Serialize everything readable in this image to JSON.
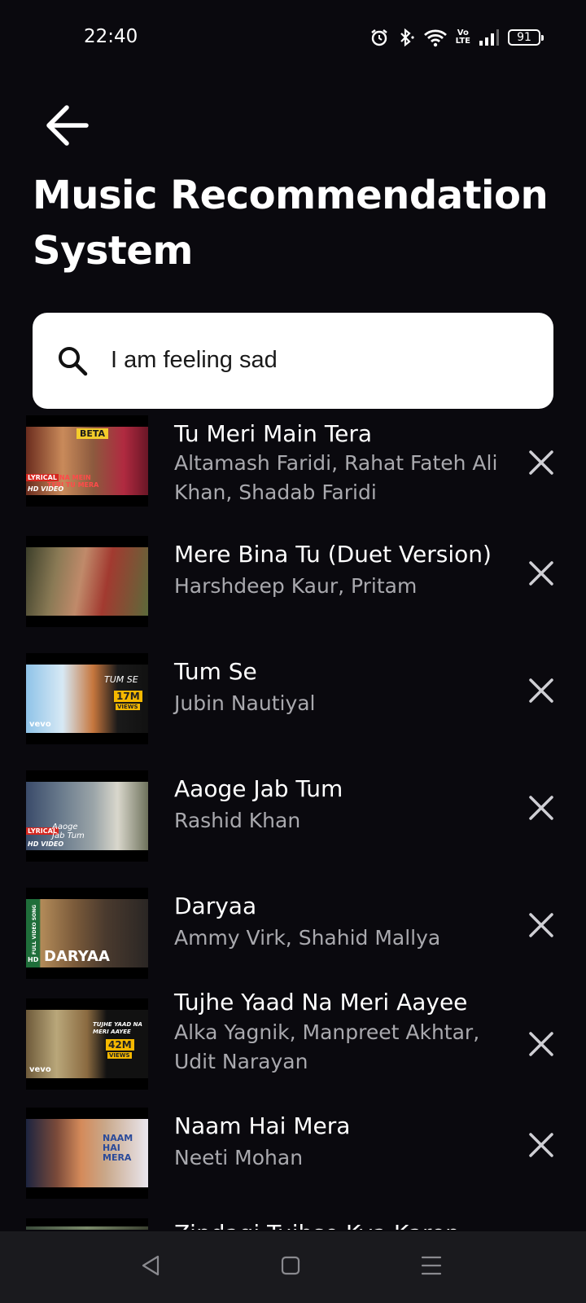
{
  "status_bar": {
    "time": "22:40",
    "battery": "91",
    "volte_top": "Vo",
    "volte_bottom": "LTE"
  },
  "header": {
    "title": "Music Recommendation System"
  },
  "search": {
    "value": "I am feeling sad",
    "placeholder": ""
  },
  "songs": [
    {
      "title": "Tu Meri Main Tera",
      "artists": "Altamash Faridi, Rahat Fateh Ali Khan, Shadab Faridi",
      "thumb": {
        "badge": "BETA",
        "caption": "SAJNA MEIN TERI TU MERA",
        "tag": "LYRICAL",
        "hd": "HD VIDEO"
      }
    },
    {
      "title": "Mere Bina Tu (Duet Version)",
      "artists": "Harshdeep Kaur, Pritam",
      "thumb": {}
    },
    {
      "title": "Tum Se",
      "artists": "Jubin Nautiyal",
      "thumb": {
        "caption": "TUM SE",
        "views": "17M",
        "views_label": "VIEWS",
        "logo": "vevo"
      }
    },
    {
      "title": "Aaoge Jab Tum",
      "artists": "Rashid Khan",
      "thumb": {
        "tag": "LYRICAL",
        "caption": "Aaoge Jab Tum",
        "hd": "HD VIDEO"
      }
    },
    {
      "title": "Daryaa",
      "artists": "Ammy Virk, Shahid Mallya",
      "thumb": {
        "caption": "DARYAA",
        "side": "FULL VIDEO SONG",
        "hd": "HD"
      }
    },
    {
      "title": "Tujhe Yaad Na Meri Aayee",
      "artists": "Alka Yagnik, Manpreet Akhtar, Udit Narayan",
      "thumb": {
        "caption": "TUJHE YAAD NA MERI AAYEE",
        "views": "42M",
        "views_label": "VIEWS",
        "logo": "vevo"
      }
    },
    {
      "title": "Naam Hai Mera",
      "artists": "Neeti Mohan",
      "thumb": {
        "caption": "NAAM HAI MERA"
      }
    },
    {
      "title": "Zindagi Tujhse Kya Karen",
      "artists": "",
      "thumb": {}
    }
  ],
  "colors": {
    "background": "#0a090e",
    "text_primary": "#ffffff",
    "text_secondary": "#a9a9ae",
    "search_bg": "#ffffff",
    "nav_bar": "#1a1a1e"
  },
  "icons": {
    "back": "arrow-left-icon",
    "search": "search-icon",
    "remove": "close-icon",
    "nav": [
      "back-triangle-icon",
      "home-square-icon",
      "recents-menu-icon"
    ]
  }
}
